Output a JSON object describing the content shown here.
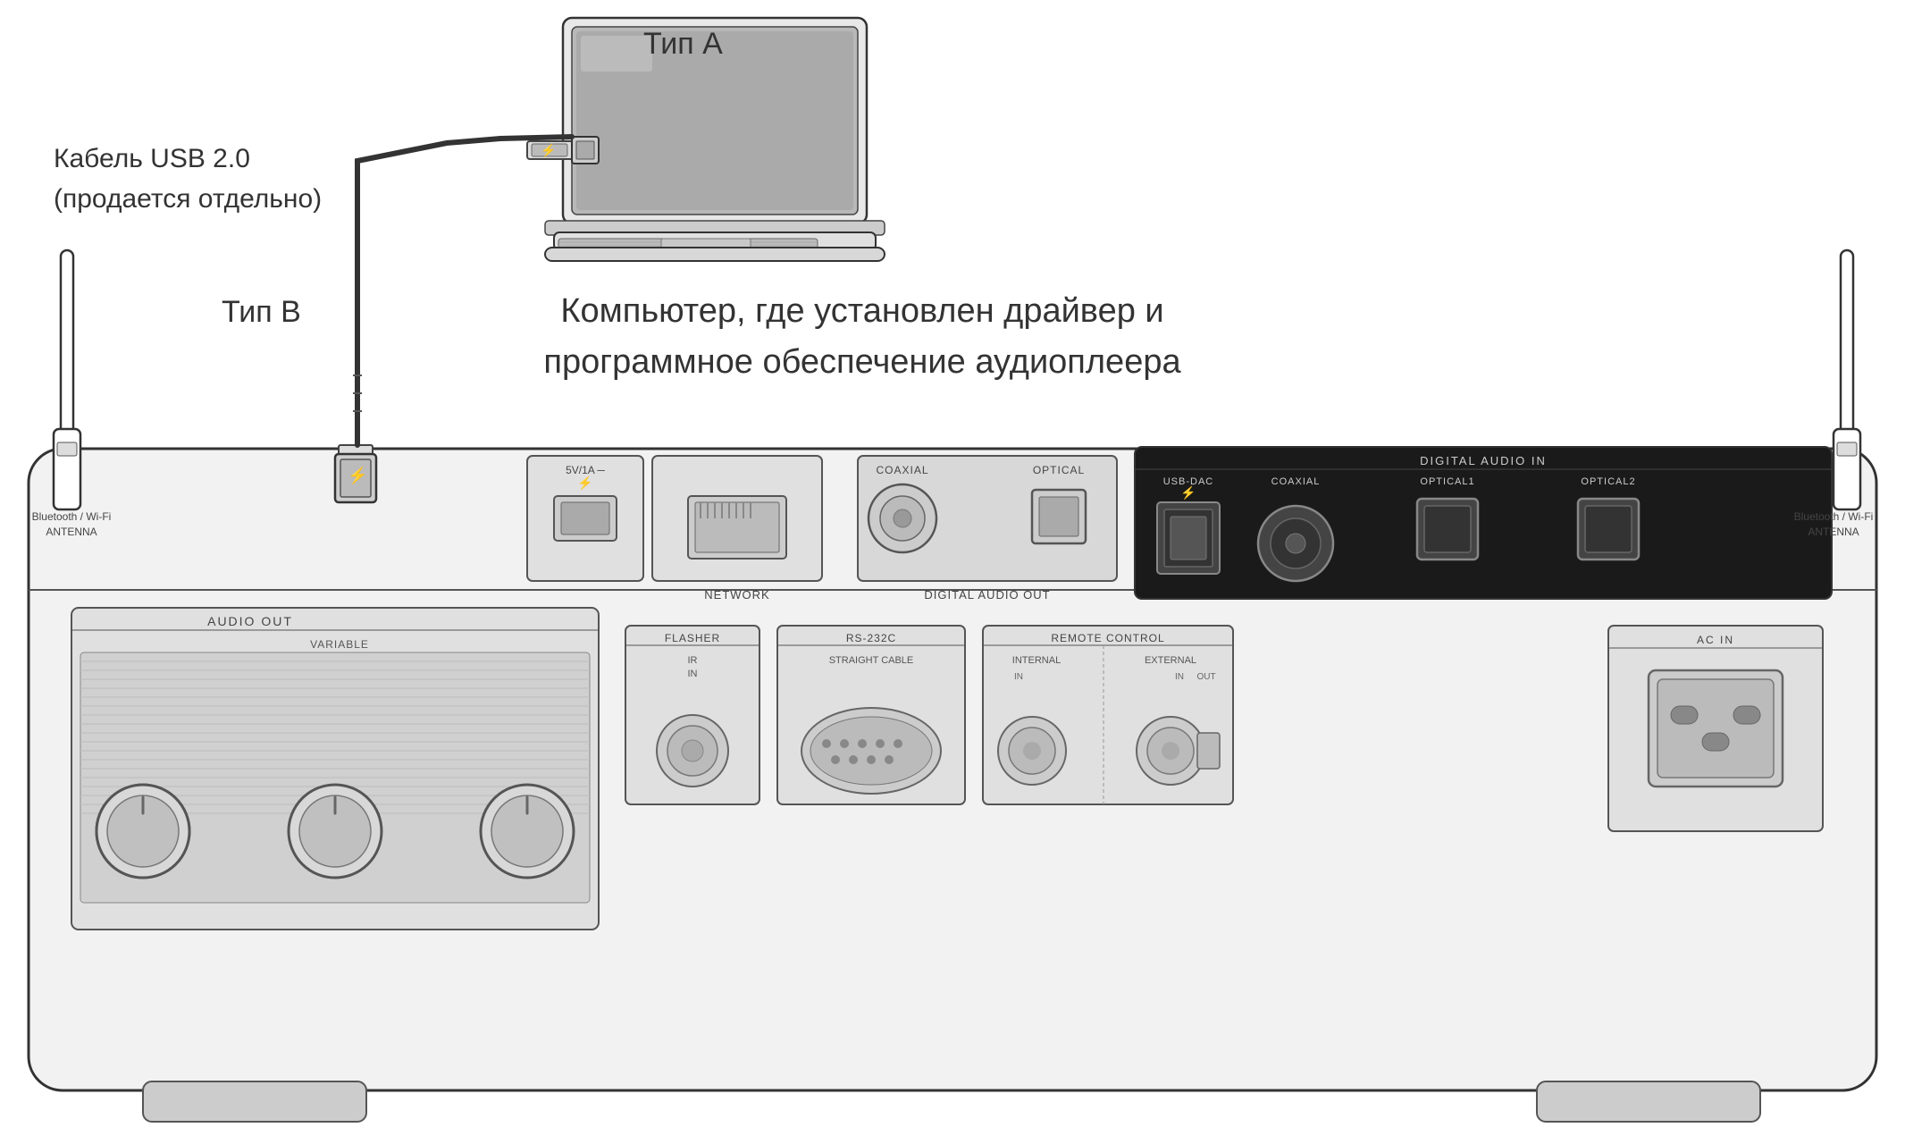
{
  "labels": {
    "usb_cable": "Кабель USB 2.0\n(продается отдельно)",
    "usb_cable_line1": "Кабель USB 2.0",
    "usb_cable_line2": "(продается отдельно)",
    "tip_a": "Тип А",
    "tip_b": "Тип В",
    "computer_desc_line1": "Компьютер, где установлен драйвер и",
    "computer_desc_line2": "программное обеспечение аудиоплеера",
    "bluetooth_antenna_left": "Bluetooth / Wi-Fi\nANTENNA",
    "bluetooth_antenna_right": "Bluetooth / Wi-Fi\nANTENNA",
    "audio_out": "AUDIO OUT",
    "variable": "VARIABLE",
    "network": "NETWORK",
    "usb_power": "5V/1A",
    "digital_audio_out": "DIGITAL AUDIO OUT",
    "coaxial": "COAXIAL",
    "optical": "OPTICAL",
    "digital_audio_in": "DIGITAL AUDIO IN",
    "usb_dac": "USB-DAC",
    "coaxial_in": "COAXIAL",
    "optical1": "OPTICAL1",
    "optical2": "OPTICAL2",
    "flasher": "FLASHER",
    "ir": "IR",
    "ir_in": "IN",
    "rs232c": "RS-232C",
    "straight_cable": "STRAIGHT CABLE",
    "remote_control": "REMOTE CONTROL",
    "internal": "INTERNAL",
    "external": "EXTERNAL",
    "in": "IN",
    "out": "OUT",
    "ac_in": "AC IN"
  },
  "colors": {
    "background": "#ffffff",
    "device_body": "#f0f0f0",
    "device_border": "#333333",
    "text_main": "#333333",
    "digital_in_bg": "#1a1a1a",
    "digital_in_text": "#ffffff"
  }
}
